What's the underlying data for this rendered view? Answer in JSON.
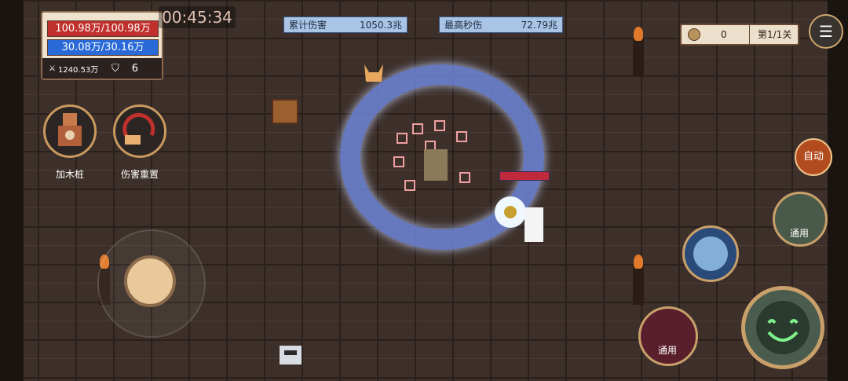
{
  "hud": {
    "hp": "100.98万/100.98万",
    "mp": "30.08万/30.16万",
    "attack": "1240.53万",
    "defense": "6",
    "timer": "00:45:34"
  },
  "damage": {
    "total_label": "累计伤害",
    "total_value": "1050.3兆",
    "max_label": "最高秒伤",
    "max_value": "72.79兆"
  },
  "top_right": {
    "coins": "0",
    "stage": "第1/1关"
  },
  "skills": {
    "dummy_label": "加木桩",
    "reset_label": "伤害重置"
  },
  "abilities": {
    "auto_label": "自动",
    "ability1_label": "通用",
    "ability3_label": "通用"
  },
  "icons": {
    "sword": "sword-icon",
    "shield": "shield-icon",
    "coin": "coin-icon",
    "menu": "menu-icon"
  }
}
